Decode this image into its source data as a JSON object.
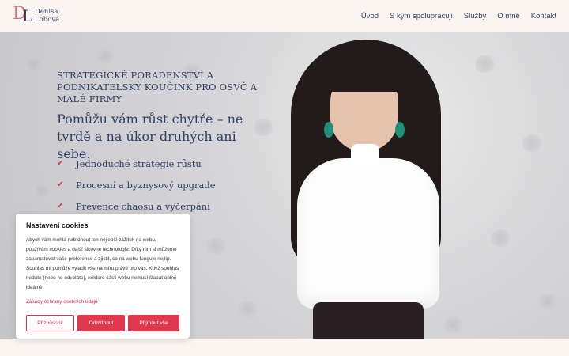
{
  "header": {
    "logo_letters": "DL",
    "logo_name_line1": "Denisa",
    "logo_name_line2": "Lobová",
    "nav": [
      "Úvod",
      "S kým spolupracuji",
      "Služby",
      "O mně",
      "Kontakt"
    ]
  },
  "hero": {
    "eyebrow": "STRATEGICKÉ PORADENSTVÍ A PODNIKATELSKÝ KOUČINK PRO OSVČ A MALÉ FIRMY",
    "headline": "Pomůžu vám růst chytře – ne tvrdě a na úkor druhých ani sebe.",
    "bullets": [
      "Jednoduché strategie růstu",
      "Procesní a byznysový upgrade",
      "Prevence chaosu a vyčerpání"
    ],
    "bullet_icon": "check-icon"
  },
  "cookie": {
    "title": "Nastavení cookies ",
    "text": "Abych vám mohla nabídnout ten nejlepší zážitek na webu, používám cookies a další šikovné technologie. Díky nim si můžeme zapamatovat vaše preference a zjistit, co na webu funguje nejlíp. Souhlas mi pomůže vyladit vše na míru právě pro vás. Když souhlas nedáte (nebo ho odvoláte), některé části webu nemusí šlapat úplně ideálně.",
    "policy_link": "Zásady ochrany osobních údajů",
    "customize": "Přizpůsobit",
    "reject": "Odmítnout",
    "accept": "Přijmout vše"
  },
  "colors": {
    "accent": "#e0384f",
    "navy": "#2e3f66",
    "background": "#fbf5f2"
  }
}
